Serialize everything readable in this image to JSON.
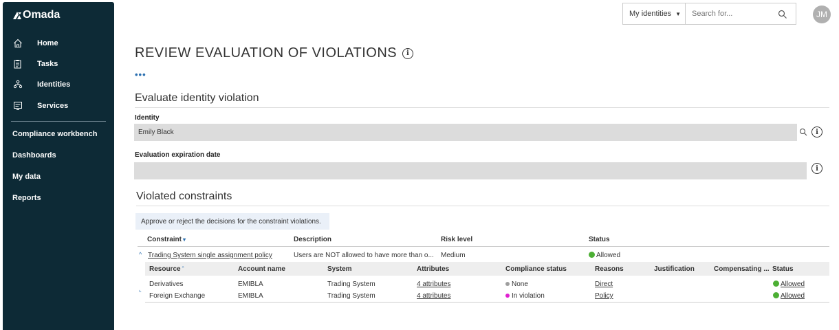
{
  "app": {
    "logo_text": "Omada"
  },
  "sidebar": {
    "items": [
      {
        "label": "Home",
        "icon": "home-icon"
      },
      {
        "label": "Tasks",
        "icon": "tasks-icon"
      },
      {
        "label": "Identities",
        "icon": "identities-icon"
      },
      {
        "label": "Services",
        "icon": "services-icon"
      }
    ],
    "links": [
      "Compliance workbench",
      "Dashboards",
      "My data",
      "Reports"
    ]
  },
  "topbar": {
    "scope_label": "My identities",
    "search_placeholder": "Search for...",
    "avatar_initials": "JM"
  },
  "page": {
    "title": "REVIEW EVALUATION OF VIOLATIONS",
    "more": "•••"
  },
  "evaluate": {
    "section_title": "Evaluate identity violation",
    "identity_label": "Identity",
    "identity_value": "Emily Black",
    "expiration_label": "Evaluation expiration date",
    "expiration_value": ""
  },
  "violated": {
    "section_title": "Violated constraints",
    "hint": "Approve or reject the decisions for the constraint violations.",
    "columns": [
      "Constraint",
      "Description",
      "Risk level",
      "Status"
    ],
    "row": {
      "constraint": "Trading System single assignment policy",
      "description": "Users are NOT allowed to have more than o...",
      "risk": "Medium",
      "status": "Allowed"
    },
    "sub_columns": [
      "Resource",
      "Account name",
      "System",
      "Attributes",
      "Compliance status",
      "Reasons",
      "Justification",
      "Compensating ...",
      "Status"
    ],
    "sub_rows": [
      {
        "resource": "Derivatives",
        "account": "EMIBLA",
        "system": "Trading System",
        "attributes": "4 attributes",
        "compliance": "None",
        "reason": "Direct",
        "status": "Allowed"
      },
      {
        "resource": "Foreign Exchange",
        "account": "EMIBLA",
        "system": "Trading System",
        "attributes": "4 attributes",
        "compliance": "In violation",
        "reason": "Policy",
        "status": "Allowed"
      }
    ]
  },
  "colors": {
    "sidebar_bg": "#0d2a36",
    "allowed": "#4caf34",
    "none": "#9e9e9e",
    "violation": "#e020d0",
    "link": "#2a6fb0"
  }
}
